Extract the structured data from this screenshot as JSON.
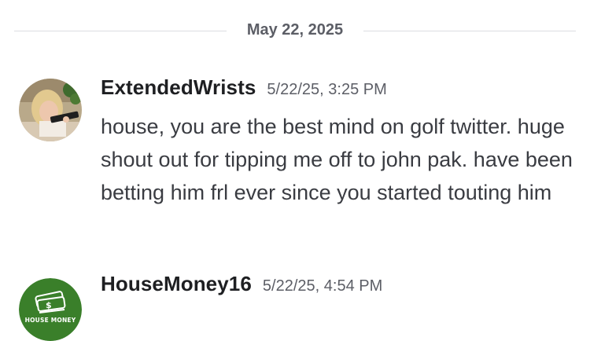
{
  "date_divider": {
    "label": "May 22, 2025"
  },
  "messages": [
    {
      "username": "ExtendedWrists",
      "timestamp": "5/22/25, 3:25 PM",
      "avatar_icon": "user-photo-avatar",
      "content": "house, you are the best mind on golf twitter. huge shout out for tipping me off to john pak. have been betting him frl ever since you started touting him"
    },
    {
      "username": "HouseMoney16",
      "timestamp": "5/22/25, 4:54 PM",
      "avatar_icon": "house-money-logo",
      "avatar_text": "HOUSE MONEY",
      "avatar_color": "#3a7f2a"
    }
  ]
}
